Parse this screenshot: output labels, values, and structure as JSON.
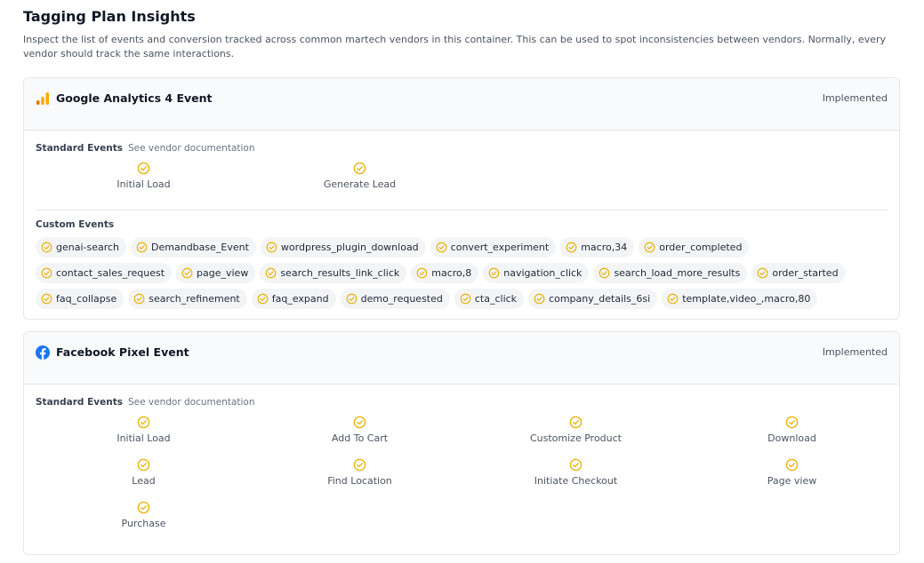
{
  "page": {
    "title": "Tagging Plan Insights",
    "description": "Inspect the list of events and conversion tracked across common martech vendors in this container. This can be used to spot inconsistencies between vendors. Normally, every vendor should track the same interactions."
  },
  "colors": {
    "check": "#eab308",
    "ga_bar_light": "#f9ab00",
    "ga_bar_dark": "#e37400",
    "facebook_blue": "#1877f2"
  },
  "vendors": [
    {
      "name": "Google Analytics 4 Event",
      "icon": "google-analytics-icon",
      "status": "Implemented",
      "standard_label": "Standard Events",
      "doc_link": "See vendor documentation",
      "standard_events": [
        "Initial Load",
        "Generate Lead"
      ],
      "custom_label": "Custom Events",
      "custom_events": [
        "genai-search",
        "Demandbase_Event",
        "wordpress_plugin_download",
        "convert_experiment",
        "macro,34",
        "order_completed",
        "contact_sales_request",
        "page_view",
        "search_results_link_click",
        "macro,8",
        "navigation_click",
        "search_load_more_results",
        "order_started",
        "faq_collapse",
        "search_refinement",
        "faq_expand",
        "demo_requested",
        "cta_click",
        "company_details_6si",
        "template,video_,macro,80"
      ]
    },
    {
      "name": "Facebook Pixel Event",
      "icon": "facebook-icon",
      "status": "Implemented",
      "standard_label": "Standard Events",
      "doc_link": "See vendor documentation",
      "standard_events": [
        "Initial Load",
        "Add To Cart",
        "Customize Product",
        "Download",
        "Lead",
        "Find Location",
        "Initiate Checkout",
        "Page view",
        "Purchase"
      ]
    }
  ]
}
